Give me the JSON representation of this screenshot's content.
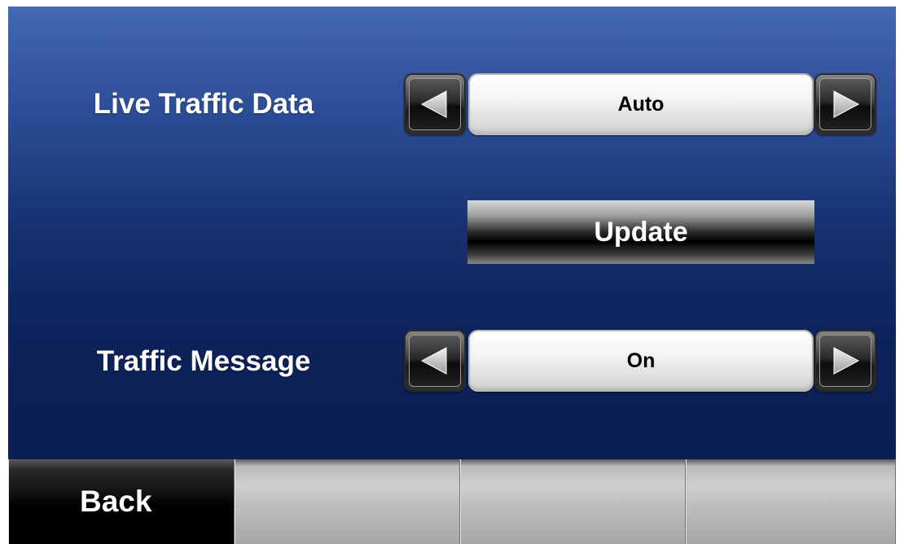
{
  "settings": {
    "live_traffic": {
      "label": "Live Traffic Data",
      "value": "Auto"
    },
    "update_label": "Update",
    "traffic_message": {
      "label": "Traffic Message",
      "value": "On"
    }
  },
  "bottom_bar": {
    "back_label": "Back",
    "tabs": [
      "",
      "",
      ""
    ]
  },
  "icons": {
    "prev": "left-arrow-icon",
    "next": "right-arrow-icon"
  },
  "colors": {
    "background_top": "#4568b3",
    "background_bottom": "#0a1f55",
    "label_text": "#ffffff",
    "value_text": "#000000"
  }
}
